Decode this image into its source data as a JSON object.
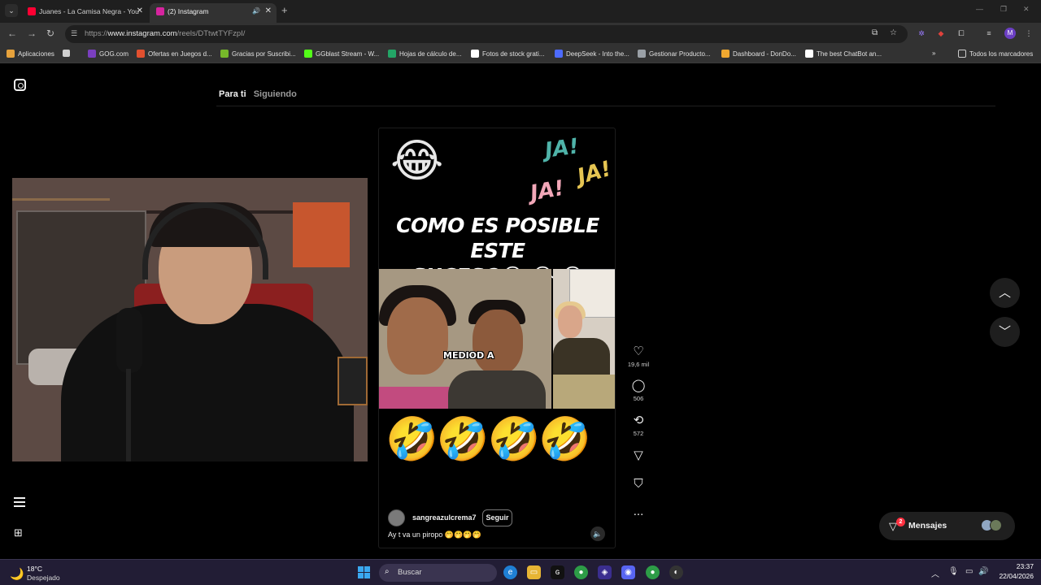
{
  "browser": {
    "tabs": [
      {
        "title": "Juanes - La Camisa Negra - You",
        "favicon_color": "#ff0033",
        "active": false
      },
      {
        "title": "(2) Instagram",
        "favicon_color": "#d6249f",
        "active": true
      }
    ],
    "address": {
      "prefix": "https://",
      "domain": "www.instagram.com",
      "path": "/reels/DTtwtTYFzpI/"
    },
    "profile_initial": "M",
    "bookmarks": [
      {
        "label": "Aplicaciones",
        "color": "#e6a23c"
      },
      {
        "label": "",
        "color": "#cfcfcf"
      },
      {
        "label": "GOG.com",
        "color": "#7a3fbf"
      },
      {
        "label": "Ofertas en Juegos d...",
        "color": "#e2502f"
      },
      {
        "label": "Gracias por Suscribi...",
        "color": "#76b82a"
      },
      {
        "label": "GGblast Stream - W...",
        "color": "#53fc18"
      },
      {
        "label": "Hojas de cálculo de...",
        "color": "#23a566"
      },
      {
        "label": "Fotos de stock grati...",
        "color": "#ffffff"
      },
      {
        "label": "DeepSeek - Into the...",
        "color": "#4d6bfe"
      },
      {
        "label": "Gestionar Producto...",
        "color": "#9aa0a6"
      },
      {
        "label": "Dashboard - DonDo...",
        "color": "#f0a830"
      },
      {
        "label": "The best ChatBot an...",
        "color": "#ffffff"
      }
    ],
    "bookmarks_more": "»",
    "all_bookmarks": "Todos los marcadores"
  },
  "instagram": {
    "feed_tabs": {
      "for_you": "Para ti",
      "following": "Siguiendo"
    },
    "reel": {
      "ja_words": [
        "JA!",
        "JA!",
        "JA!"
      ],
      "title_line1": "COMO ES POSIBLE ESTE",
      "title_line2": "SUCESO😂 😂 😂",
      "top_emoji": "😂",
      "clip_caption": "MEDIOD A",
      "bottom_emojis": "🤣🤣🤣🤣",
      "author": "sangreazulcrema7",
      "follow": "Seguir",
      "description": "Ay t va un piropo 🤭🤭🤭🤭"
    },
    "actions": {
      "likes": "19,6 mil",
      "comments": "506",
      "reposts": "572",
      "more": "..."
    },
    "messages": {
      "label": "Mensajes",
      "badge": "2"
    }
  },
  "taskbar": {
    "weather_temp": "18°C",
    "weather_desc": "Despejado",
    "search_placeholder": "Buscar",
    "time": "23:37",
    "date": "22/04/2026"
  }
}
